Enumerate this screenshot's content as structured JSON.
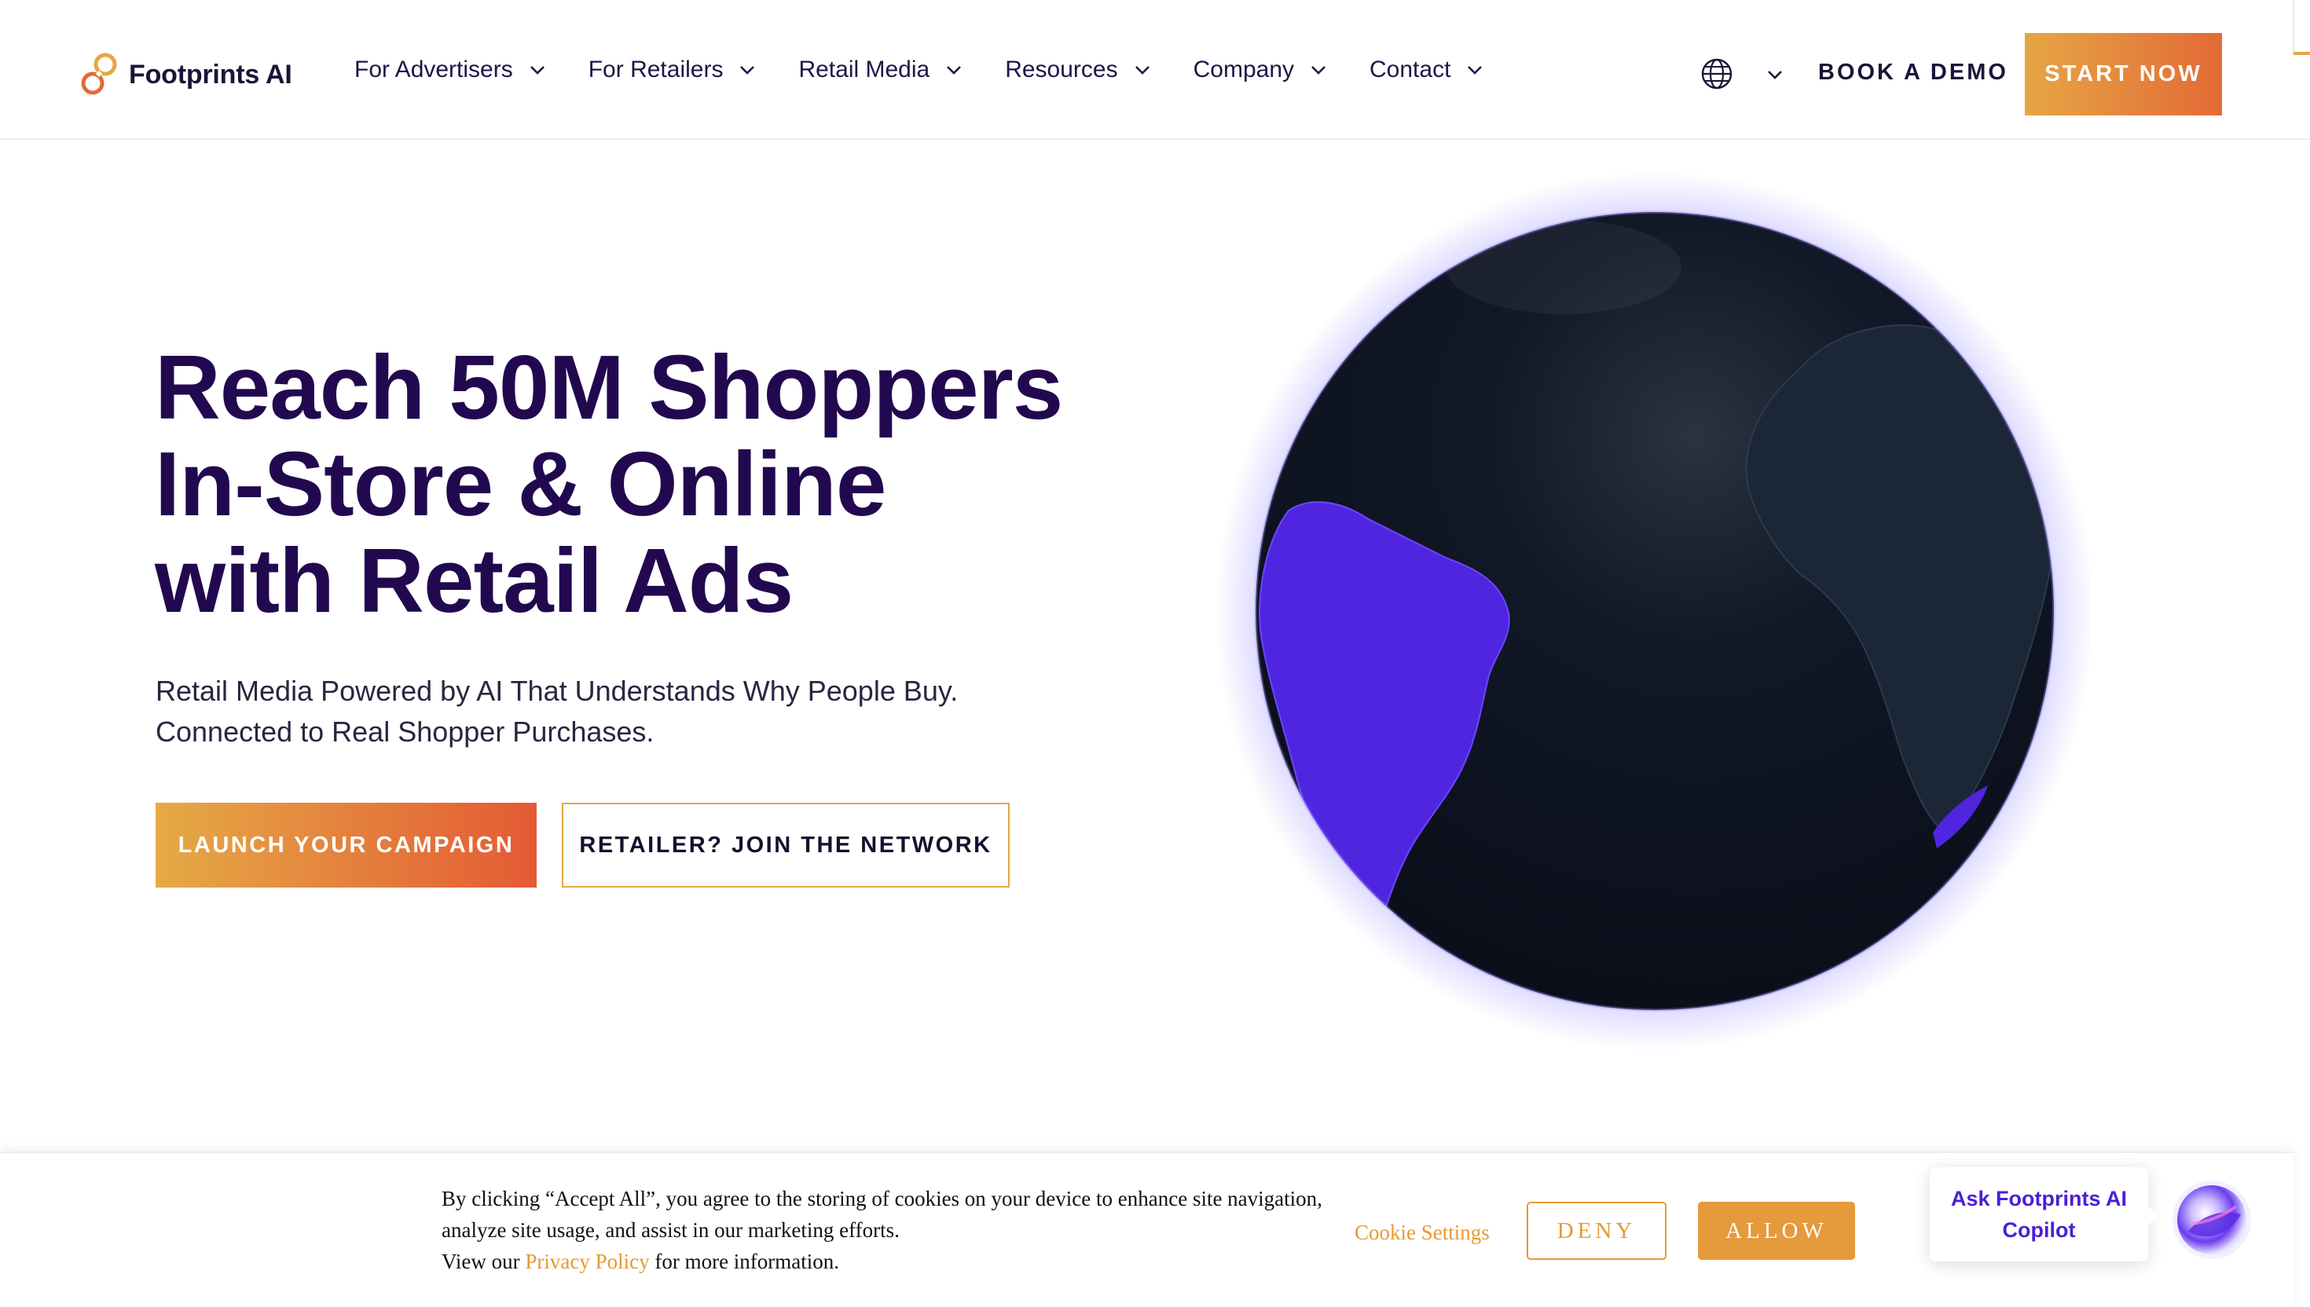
{
  "header": {
    "logo_text": "Footprints AI",
    "nav": [
      {
        "label": "For Advertisers"
      },
      {
        "label": "For Retailers"
      },
      {
        "label": "Retail Media"
      },
      {
        "label": "Resources"
      },
      {
        "label": "Company"
      },
      {
        "label": "Contact"
      }
    ],
    "language_icon": "globe-icon",
    "book_demo": "BOOK A DEMO",
    "start_now": "START NOW"
  },
  "hero": {
    "headline": [
      "Reach 50M Shoppers",
      "In-Store & Online",
      "with Retail Ads"
    ],
    "subtitle": [
      "Retail Media Powered by AI That Understands Why People Buy.",
      "Connected to Real Shopper Purchases."
    ],
    "cta_primary": "LAUNCH YOUR CAMPAIGN",
    "cta_secondary": "RETAILER? JOIN THE NETWORK"
  },
  "cookie": {
    "text_line1": "By clicking “Accept All”, you agree to the storing of cookies on your device to enhance site navigation,",
    "text_line2": "analyze site usage, and assist in our marketing efforts.",
    "text_line3_prefix": "View our ",
    "privacy_link": "Privacy Policy",
    "text_line3_suffix": " for more information.",
    "settings": "Cookie Settings",
    "deny": "DENY",
    "allow": "ALLOW"
  },
  "copilot": {
    "line1": "Ask Footprints AI",
    "line2": "Copilot"
  },
  "colors": {
    "accent_orange": "#e5a645",
    "accent_red": "#e45a35",
    "headline": "#22094f",
    "globe_land": "#5025e0",
    "globe_ocean": "#0c111c"
  }
}
